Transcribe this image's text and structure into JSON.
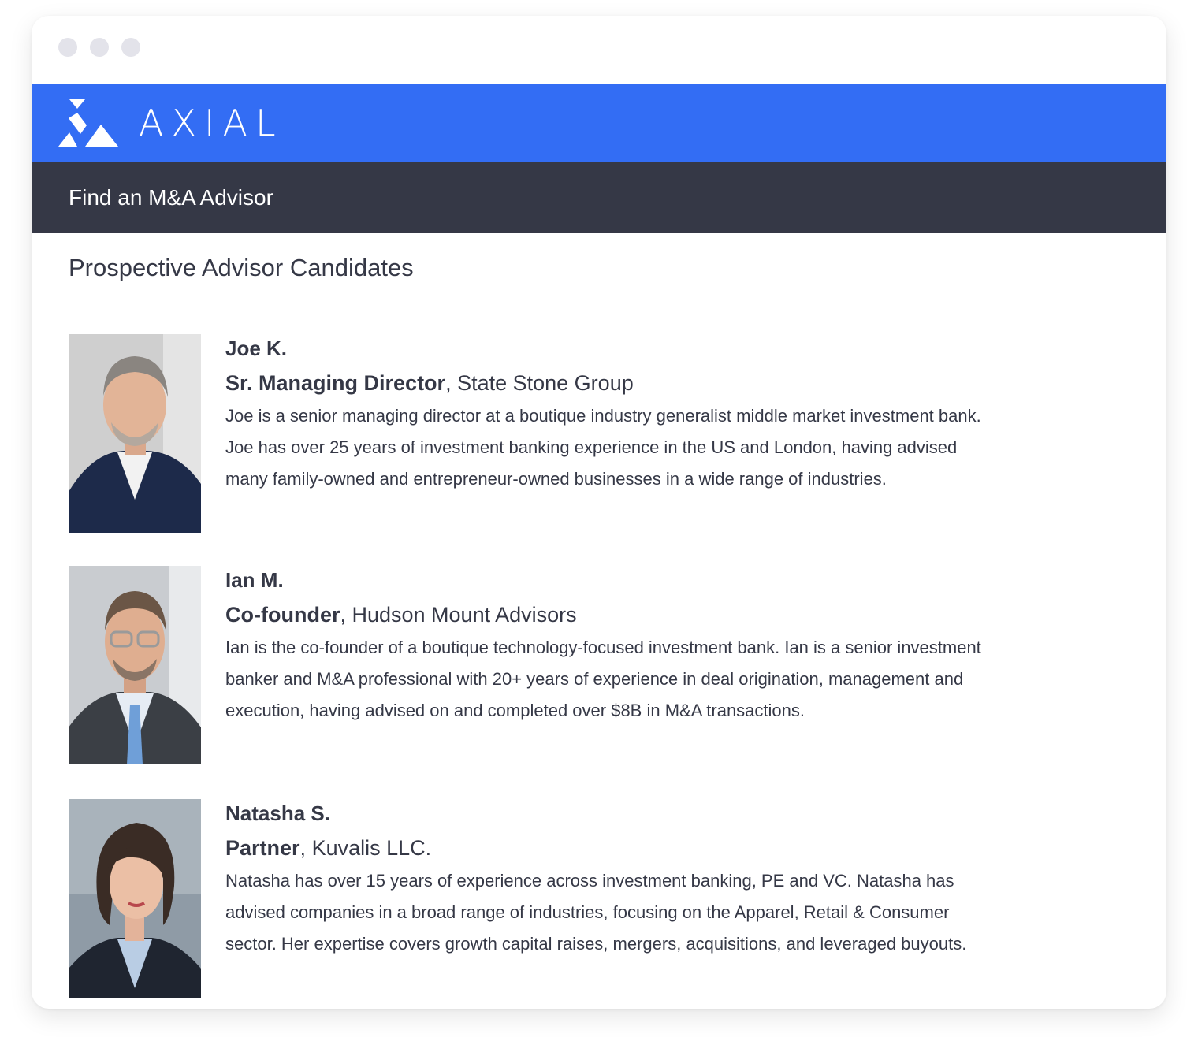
{
  "window": {
    "traffic_lights": [
      "close",
      "minimize",
      "maximize"
    ]
  },
  "brand": {
    "name": "AXIAL",
    "color": "#336df4",
    "logo_icon": "axial-logo-icon"
  },
  "navbar": {
    "title": "Find an M&A Advisor",
    "color": "#353846"
  },
  "main": {
    "section_title": "Prospective Advisor Candidates",
    "advisors": [
      {
        "name": "Joe K.",
        "role": "Sr. Managing Director",
        "separator": ", ",
        "firm": "State Stone Group",
        "bio": "Joe is a senior managing director at a boutique industry generalist middle market investment bank.\nJoe has over 25 years of investment banking experience in the US and London, having advised\nmany family-owned and entrepreneur-owned businesses in a wide range of industries.",
        "photo": "portrait-photo"
      },
      {
        "name": "Ian M.",
        "role": "Co-founder",
        "separator": ", ",
        "firm": "Hudson Mount Advisors",
        "bio": "Ian is the co-founder of a boutique technology-focused investment bank. Ian is a senior investment\nbanker and M&A professional with 20+ years of experience in deal origination, management and\nexecution, having advised on and completed over $8B in M&A transactions.",
        "photo": "portrait-photo"
      },
      {
        "name": "Natasha S.",
        "role": "Partner",
        "separator": ", ",
        "firm": "Kuvalis LLC.",
        "bio": "Natasha has over 15 years of experience across investment banking, PE and VC. Natasha has\nadvised companies in a broad range of industries, focusing on the Apparel, Retail & Consumer\nsector. Her expertise covers growth capital raises, mergers, acquisitions, and leveraged buyouts.",
        "photo": "portrait-photo"
      }
    ]
  }
}
